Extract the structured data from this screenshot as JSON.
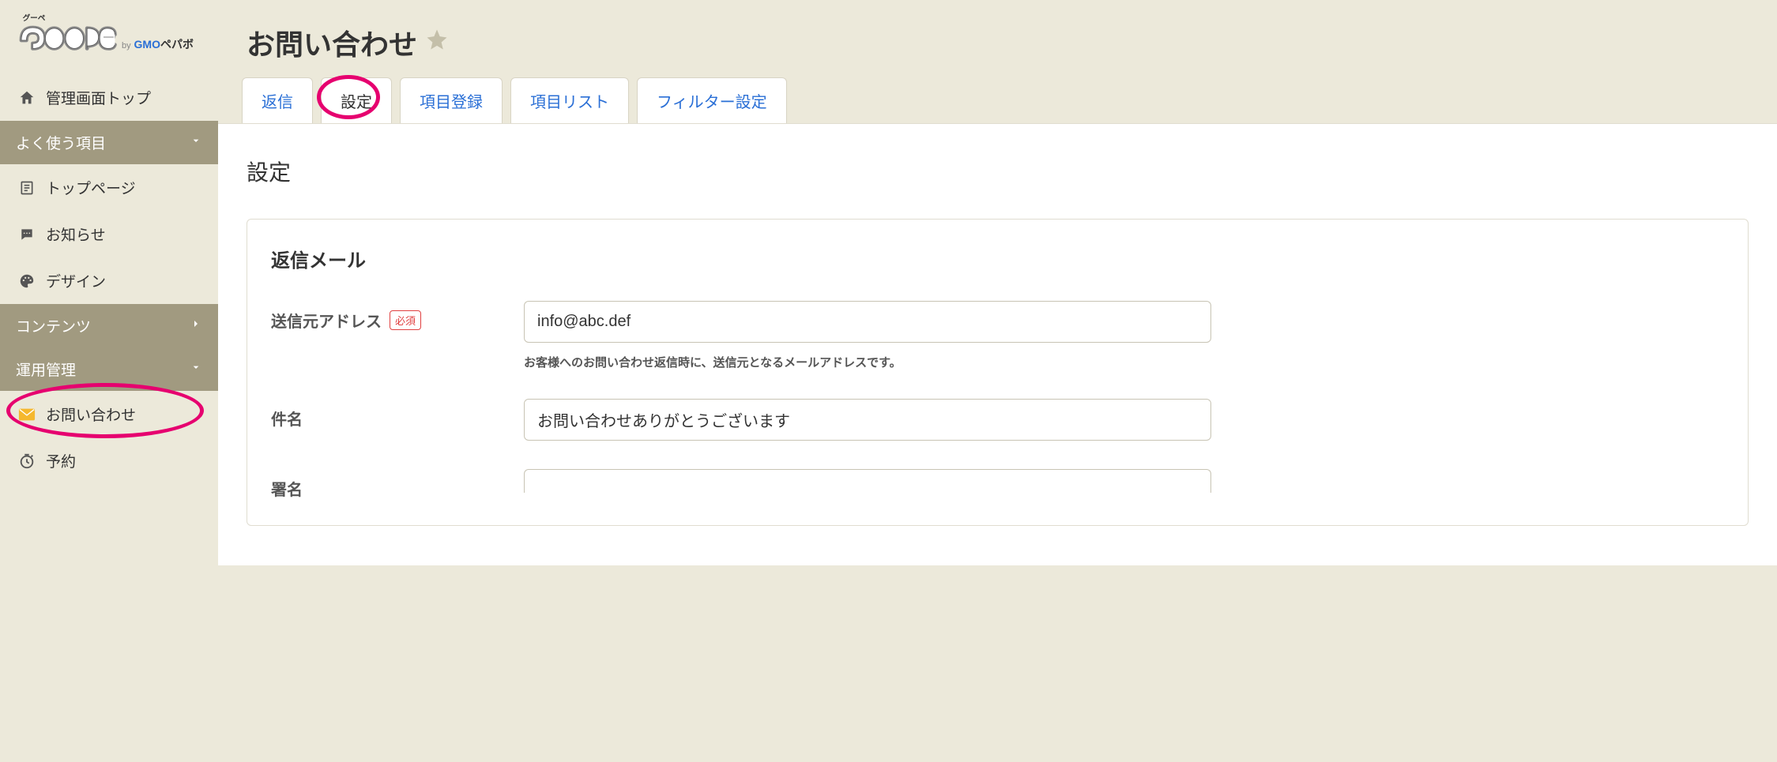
{
  "logo": {
    "ruby": "グーペ",
    "name": "Goope",
    "by": "by",
    "company_prefix": "GMO",
    "company_suffix": "ペパボ"
  },
  "sidebar": {
    "top_link": "管理画面トップ",
    "section_frequent": "よく使う項目",
    "item_toppage": "トップページ",
    "item_news": "お知らせ",
    "item_design": "デザイン",
    "section_contents": "コンテンツ",
    "section_operation": "運用管理",
    "item_contact": "お問い合わせ",
    "item_reservation": "予約"
  },
  "page": {
    "title": "お問い合わせ"
  },
  "tabs": {
    "reply": "返信",
    "settings": "設定",
    "item_register": "項目登録",
    "item_list": "項目リスト",
    "filter_settings": "フィルター設定"
  },
  "content": {
    "heading": "設定",
    "card_title": "返信メール",
    "from_address": {
      "label": "送信元アドレス",
      "required": "必須",
      "value": "info@abc.def",
      "help": "お客様へのお問い合わせ返信時に、送信元となるメールアドレスです。"
    },
    "subject": {
      "label": "件名",
      "value": "お問い合わせありがとうございます"
    },
    "signature": {
      "label": "署名"
    }
  }
}
